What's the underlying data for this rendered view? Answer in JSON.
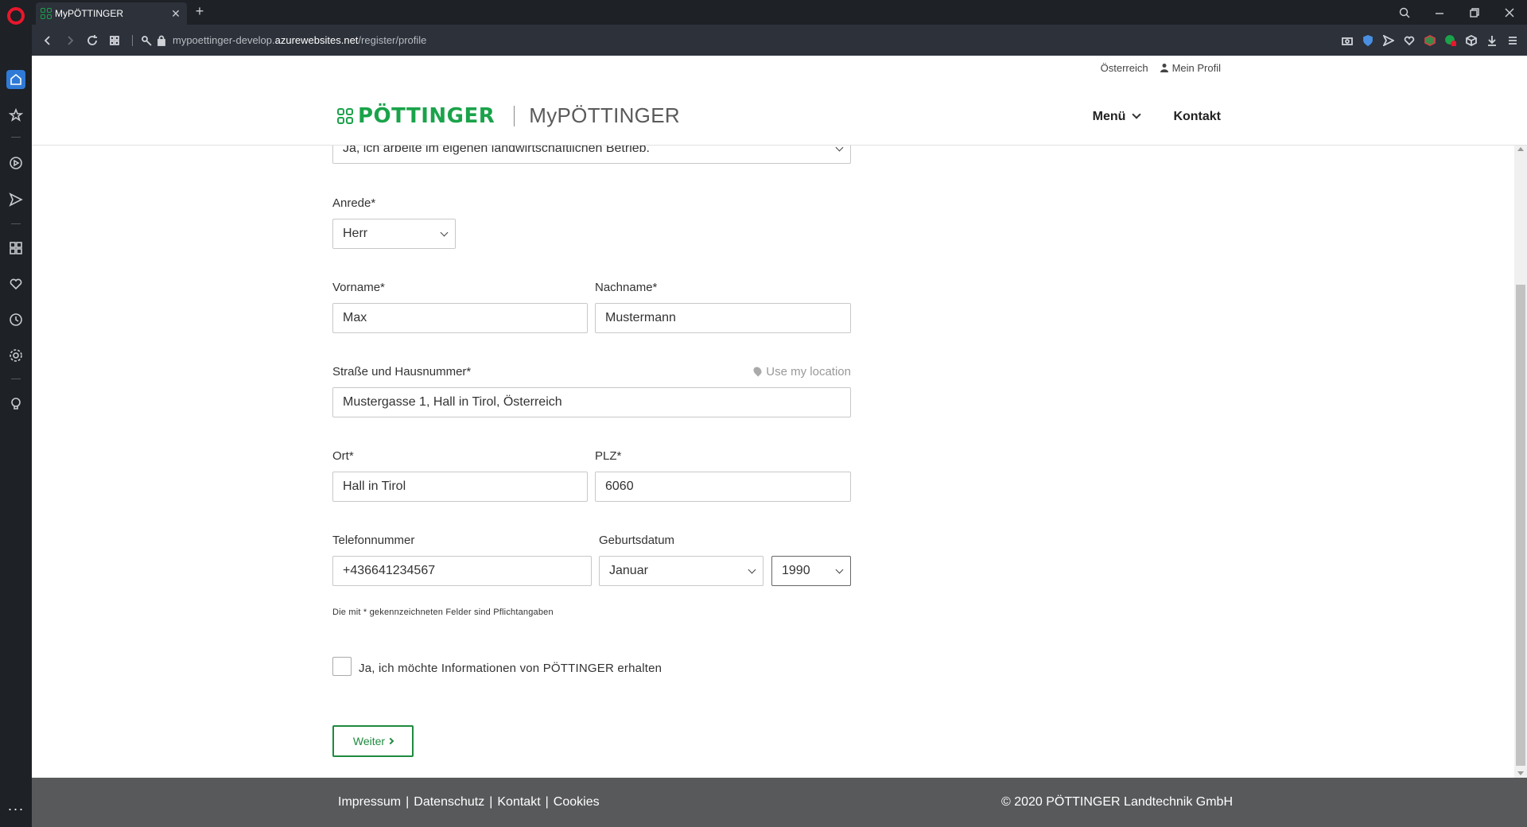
{
  "browser": {
    "tab_title": "MyPÖTTINGER",
    "url_prefix": "mypoettinger-develop.",
    "url_domain": "azurewebsites.net",
    "url_path": "/register/profile"
  },
  "header": {
    "country": "Österreich",
    "profile": "Mein Profil",
    "logo_word": "PÖTTINGER",
    "logo_sub": "MyPÖTTINGER",
    "nav_menu": "Menü",
    "nav_contact": "Kontakt"
  },
  "form": {
    "farm_select_value": "Ja, ich arbeite im eigenen landwirtschaftlichen Betrieb.",
    "salutation_label": "Anrede*",
    "salutation_value": "Herr",
    "firstname_label": "Vorname*",
    "firstname_value": "Max",
    "lastname_label": "Nachname*",
    "lastname_value": "Mustermann",
    "street_label": "Straße und Hausnummer*",
    "use_location": "Use my location",
    "street_value": "Mustergasse 1, Hall in Tirol, Österreich",
    "city_label": "Ort*",
    "city_value": "Hall in Tirol",
    "zip_label": "PLZ*",
    "zip_value": "6060",
    "phone_label": "Telefonnummer",
    "phone_value": "+436641234567",
    "birthdate_label": "Geburtsdatum",
    "birth_month": "Januar",
    "birth_year": "1990",
    "required_note": "Die mit * gekennzeichneten Felder sind Pflichtangaben",
    "newsletter_label": "Ja, ich möchte Informationen von PÖTTINGER erhalten",
    "next_button": "Weiter"
  },
  "footer": {
    "links": [
      "Impressum",
      "Datenschutz",
      "Kontakt",
      "Cookies"
    ],
    "copyright": "© 2020 PÖTTINGER Landtechnik GmbH"
  },
  "colors": {
    "brand_green": "#1aa34a",
    "footer_bg": "#58595b",
    "browser_dark": "#1e2126"
  }
}
